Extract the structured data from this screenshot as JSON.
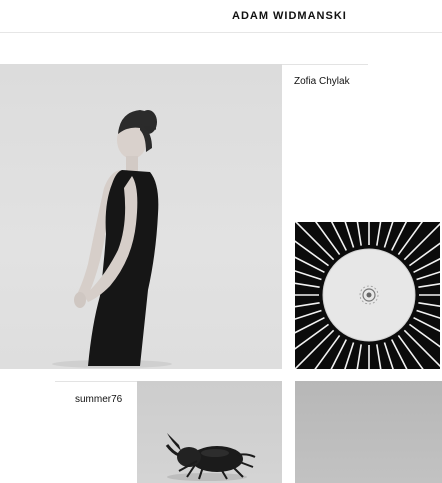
{
  "header": {
    "brand": "ADAM WIDMANSKI"
  },
  "grid": {
    "credits": [
      {
        "name": "Zofia Chylak"
      },
      {
        "name": "summer76"
      }
    ],
    "photos": [
      {
        "subject": "portrait-woman"
      },
      {
        "subject": "dome-light"
      },
      {
        "subject": "beetle"
      },
      {
        "subject": "grey-abstract"
      }
    ]
  },
  "colors": {
    "text": "#111111",
    "background": "#ffffff"
  }
}
